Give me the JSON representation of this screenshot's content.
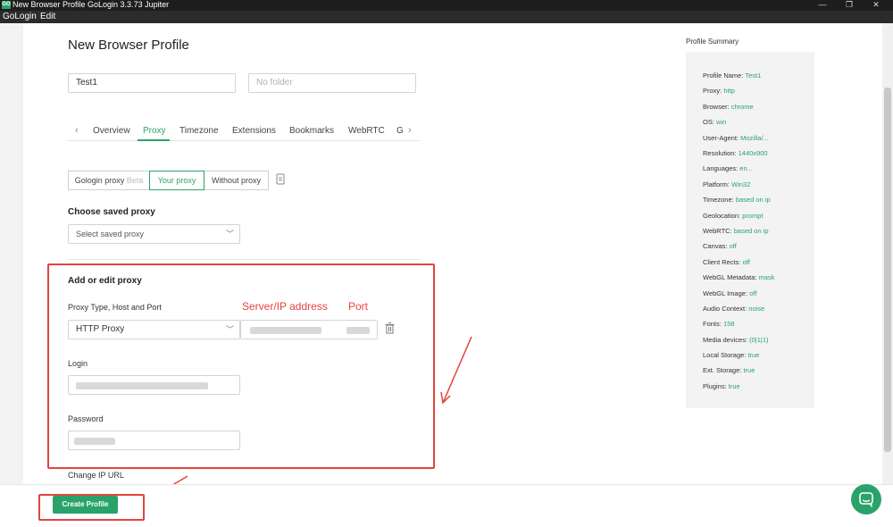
{
  "window": {
    "title": "New Browser Profile GoLogin 3.3.73 Jupiter",
    "logo_text": "GO",
    "minimize_glyph": "—",
    "maximize_glyph": "❐",
    "close_glyph": "✕"
  },
  "menu": {
    "items": [
      "GoLogin",
      "Edit"
    ]
  },
  "page": {
    "title": "New Browser Profile",
    "profile_name_value": "Test1",
    "folder_placeholder": "No folder"
  },
  "tabs": {
    "prev_glyph": "‹",
    "next_glyph": "›",
    "items": [
      "Overview",
      "Proxy",
      "Timezone",
      "Extensions",
      "Bookmarks",
      "WebRTC",
      "G"
    ],
    "active": "Proxy"
  },
  "proxy_mode": {
    "options": [
      {
        "label": "Gologin proxy",
        "badge": "Beta"
      },
      {
        "label": "Your proxy"
      },
      {
        "label": "Without proxy"
      }
    ],
    "active": "Your proxy"
  },
  "saved_proxy": {
    "heading": "Choose saved proxy",
    "placeholder": "Select saved proxy"
  },
  "edit_proxy": {
    "heading": "Add or edit proxy",
    "type_label": "Proxy Type, Host and Port",
    "type_value": "HTTP Proxy",
    "login_label": "Login",
    "password_label": "Password",
    "change_ip_label": "Change IP URL"
  },
  "annotations": {
    "server_label": "Server/IP address",
    "port_label": "Port"
  },
  "summary": {
    "title": "Profile Summary",
    "rows": [
      {
        "key": "Profile Name:",
        "value": "Test1"
      },
      {
        "key": "Proxy:",
        "value": "http"
      },
      {
        "key": "Browser:",
        "value": "chrome"
      },
      {
        "key": "OS:",
        "value": "win"
      },
      {
        "key": "User-Agent:",
        "value": "Mozilla/..."
      },
      {
        "key": "Resolution:",
        "value": "1440x900"
      },
      {
        "key": "Languages:",
        "value": "en..."
      },
      {
        "key": "Platform:",
        "value": "Win32"
      },
      {
        "key": "Timezone:",
        "value": "based on ip"
      },
      {
        "key": "Geolocation:",
        "value": "prompt"
      },
      {
        "key": "WebRTC:",
        "value": "based on ip"
      },
      {
        "key": "Canvas:",
        "value": "off"
      },
      {
        "key": "Client Rects:",
        "value": "off"
      },
      {
        "key": "WebGL Metadata:",
        "value": "mask"
      },
      {
        "key": "WebGL Image:",
        "value": "off"
      },
      {
        "key": "Audio Context:",
        "value": "noise"
      },
      {
        "key": "Fonts:",
        "value": "158"
      },
      {
        "key": "Media devices:",
        "value": "(0|1|1)"
      },
      {
        "key": "Local Storage:",
        "value": "true"
      },
      {
        "key": "Ext. Storage:",
        "value": "true"
      },
      {
        "key": "Plugins:",
        "value": "true"
      }
    ]
  },
  "footer": {
    "create_label": "Create Profile"
  },
  "colors": {
    "accent": "#2aa36b",
    "annotation": "#e3443f"
  }
}
